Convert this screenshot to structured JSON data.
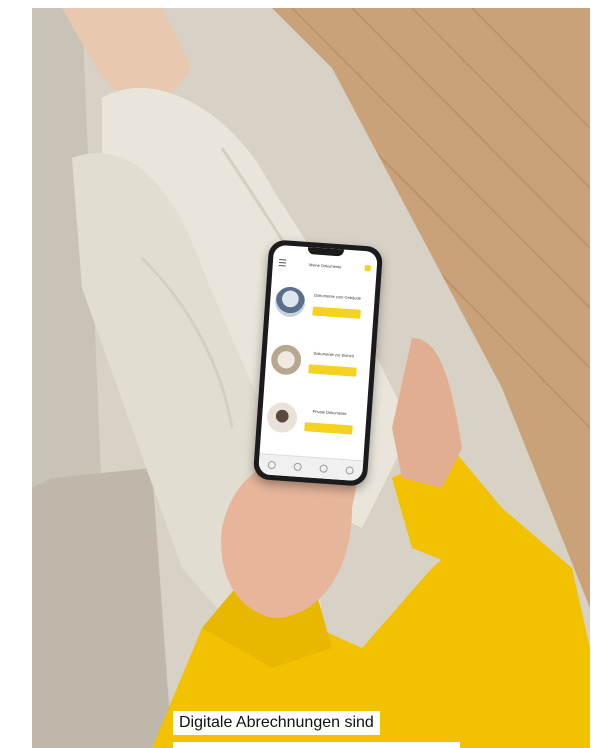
{
  "caption": {
    "text": "Digitale Abrechnungen sind"
  },
  "phone_app": {
    "header_title": "Meine Dokumente",
    "cards": [
      {
        "title": "Dokumente zum Gebäude",
        "button": ""
      },
      {
        "title": "Dokumente zur Einheit",
        "button": ""
      },
      {
        "title": "Private Dokumente",
        "button": ""
      }
    ],
    "accent_color": "#f4d21f"
  },
  "colors": {
    "sweater": "#f2c200",
    "floor": "#c9a27a",
    "sofa": "#d8d1c6",
    "pants": "#e9e5da"
  }
}
